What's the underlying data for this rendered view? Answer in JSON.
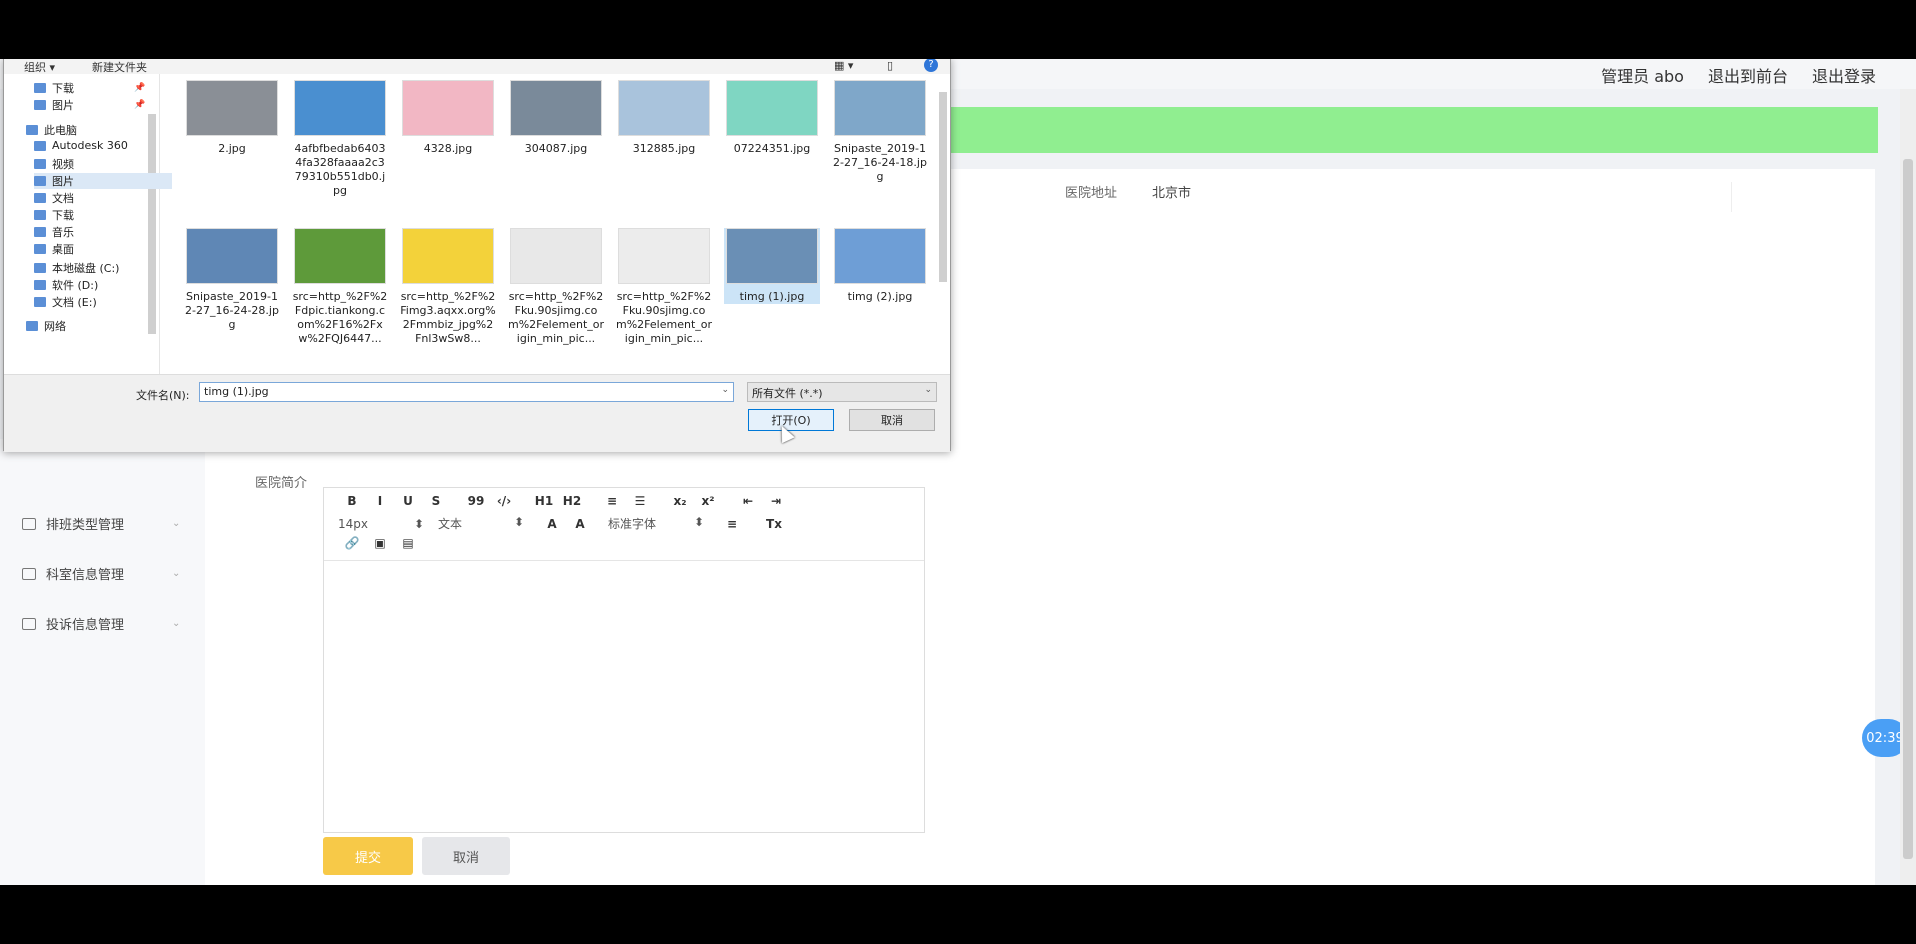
{
  "topbar": {
    "admin_label": "管理员 abo",
    "frontend_link": "退出到前台",
    "logout_link": "退出登录"
  },
  "form": {
    "address_label": "医院地址",
    "address_value": "北京市",
    "intro_label": "医院简介",
    "save_label": "提交",
    "cancel_label": "取消"
  },
  "editor_toolbar": {
    "row1": [
      "B",
      "I",
      "U",
      "S",
      "99",
      "‹/›",
      "H1",
      "H2",
      "≡",
      "☰",
      "x₂",
      "x²",
      "⇤",
      "⇥"
    ],
    "font_size": "14px",
    "block_type": "文本",
    "font_family": "标准字体"
  },
  "sidebar": {
    "items": [
      {
        "label": "排班类型管理"
      },
      {
        "label": "科室信息管理"
      },
      {
        "label": "投诉信息管理"
      }
    ]
  },
  "timer": "02:39",
  "dialog": {
    "cmd_organize": "组织 ▾",
    "cmd_new_folder": "新建文件夹",
    "nav": [
      {
        "label": "下载",
        "pinned": true
      },
      {
        "label": "图片",
        "pinned": true
      },
      {
        "label": "此电脑"
      },
      {
        "label": "Autodesk 360"
      },
      {
        "label": "视频"
      },
      {
        "label": "图片"
      },
      {
        "label": "文档"
      },
      {
        "label": "下载"
      },
      {
        "label": "音乐"
      },
      {
        "label": "桌面"
      },
      {
        "label": "本地磁盘 (C:)"
      },
      {
        "label": "软件 (D:)"
      },
      {
        "label": "文档 (E:)"
      },
      {
        "label": "网络"
      }
    ],
    "files": [
      {
        "name": "2.jpg",
        "color": "#8a8f96"
      },
      {
        "name": "4afbfbedab64034fa328faaaa2c379310b551db0.jpg",
        "color": "#4a8fd0"
      },
      {
        "name": "4328.jpg",
        "color": "#f2b7c4"
      },
      {
        "name": "304087.jpg",
        "color": "#7a8a9a"
      },
      {
        "name": "312885.jpg",
        "color": "#a9c3dc"
      },
      {
        "name": "07224351.jpg",
        "color": "#7fd6c2"
      },
      {
        "name": "Snipaste_2019-12-27_16-24-18.jpg",
        "color": "#7fa7c9"
      },
      {
        "name": "Snipaste_2019-12-27_16-24-28.jpg",
        "color": "#5f87b5"
      },
      {
        "name": "src=http_%2F%2Fdpic.tiankong.com%2F16%2Fxw%2FQJ6447...",
        "color": "#5e9a3a"
      },
      {
        "name": "src=http_%2F%2Fimg3.aqxx.org%2Fmmbiz_jpg%2Fnl3wSw8...",
        "color": "#f3d23a"
      },
      {
        "name": "src=http_%2F%2Fku.90sjimg.com%2Felement_origin_min_pic...",
        "color": "#e8e8e8"
      },
      {
        "name": "src=http_%2F%2Fku.90sjimg.com%2Felement_origin_min_pic...",
        "color": "#ececec"
      },
      {
        "name": "timg (1).jpg",
        "color": "#6a8fb5",
        "selected": true
      },
      {
        "name": "timg (2).jpg",
        "color": "#6e9ed6"
      }
    ],
    "filename_label": "文件名(N):",
    "filename_value": "timg (1).jpg",
    "filetype_value": "所有文件 (*.*)",
    "open_label": "打开(O)",
    "cancel_label": "取消"
  }
}
